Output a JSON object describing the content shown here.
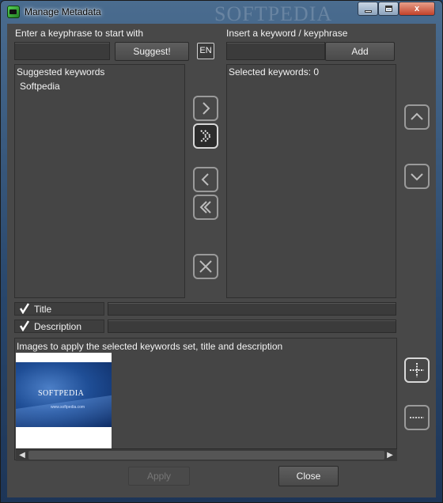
{
  "window": {
    "title": "Manage Metadata",
    "watermark": "SOFTPEDIA",
    "minimize_glyph": "",
    "maximize_glyph": "",
    "close_glyph": "x"
  },
  "left": {
    "keyphrase_label": "Enter a keyphrase to start with",
    "keyphrase_value": "",
    "suggest_label": "Suggest!",
    "language_label": "EN",
    "suggested_header": "Suggested keywords",
    "suggested_items": [
      "Softpedia"
    ]
  },
  "right": {
    "insert_label": "Insert a keyword / keyphrase",
    "insert_value": "",
    "add_label": "Add",
    "selected_header": "Selected keywords: 0"
  },
  "transfer_buttons": {
    "add_one_icon": "chevron-right-icon",
    "add_all_icon": "double-chevron-right-icon",
    "remove_one_icon": "chevron-left-icon",
    "remove_all_icon": "double-chevron-left-icon",
    "clear_icon": "x-icon"
  },
  "reorder_buttons": {
    "up_icon": "chevron-up-icon",
    "down_icon": "chevron-down-icon"
  },
  "fields": {
    "title_label": "Title",
    "title_checked": true,
    "title_value": "",
    "description_label": "Description",
    "description_checked": true,
    "description_value": ""
  },
  "images": {
    "header": "Images to apply the selected keywords set, title and description",
    "thumbnail_brand": "SOFTPEDIA",
    "thumbnail_url": "www.softpedia.com",
    "add_icon": "add-images-icon",
    "remove_icon": "remove-images-icon"
  },
  "footer": {
    "apply_label": "Apply",
    "close_label": "Close"
  },
  "colors": {
    "panel_bg": "#484848",
    "title_bar": "#4a6c8f"
  }
}
